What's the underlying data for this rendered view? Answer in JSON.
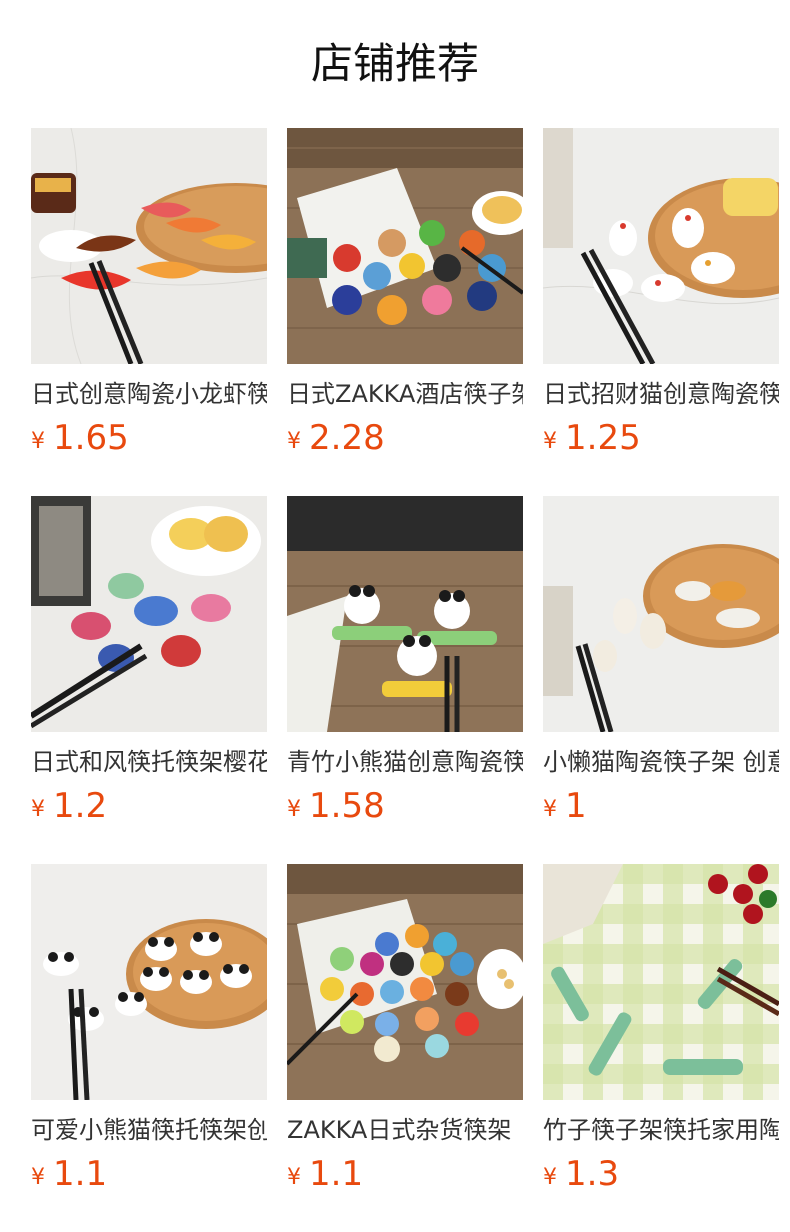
{
  "header": {
    "title": "店铺推荐"
  },
  "currency_symbol": "¥",
  "products": [
    {
      "name": "日式创意陶瓷小龙虾筷架",
      "price": "1.65",
      "image_icon": "koi-fish-chopstick-rest-photo"
    },
    {
      "name": "日式ZAKKA酒店筷子架",
      "price": "2.28",
      "image_icon": "round-bird-chopstick-rest-photo"
    },
    {
      "name": "日式招财猫创意陶瓷筷架",
      "price": "1.25",
      "image_icon": "lucky-cat-chopstick-rest-photo"
    },
    {
      "name": "日式和风筷托筷架樱花",
      "price": "1.2",
      "image_icon": "floral-pebble-chopstick-rest-photo"
    },
    {
      "name": "青竹小熊猫创意陶瓷筷架",
      "price": "1.58",
      "image_icon": "panda-bamboo-chopstick-rest-photo"
    },
    {
      "name": "小懒猫陶瓷筷子架 创意",
      "price": "1",
      "image_icon": "lazy-cat-chopstick-rest-photo"
    },
    {
      "name": "可爱小熊猫筷托筷架创意",
      "price": "1.1",
      "image_icon": "panda-chopstick-rest-photo"
    },
    {
      "name": "ZAKKA日式杂货筷架",
      "price": "1.1",
      "image_icon": "flower-chopstick-rest-photo"
    },
    {
      "name": "竹子筷子架筷托家用陶瓷",
      "price": "1.3",
      "image_icon": "bamboo-chopstick-rest-photo"
    }
  ],
  "colors": {
    "price": "#e8490e",
    "title": "#111111",
    "text": "#333333"
  }
}
